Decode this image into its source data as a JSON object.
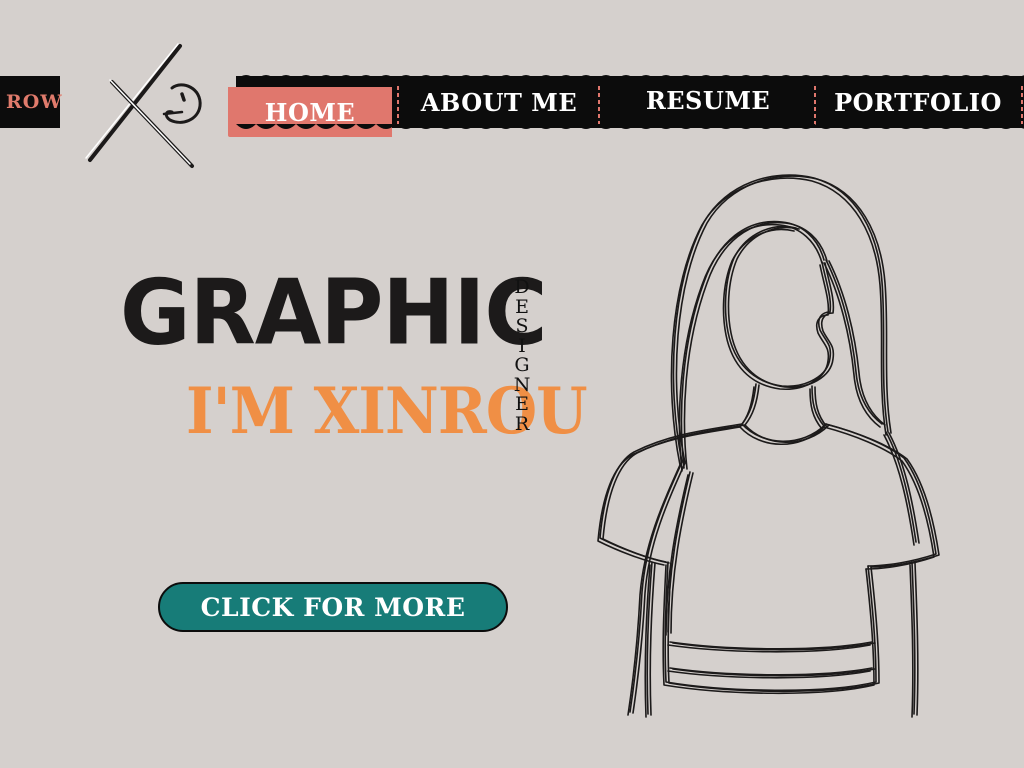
{
  "edge_tab": {
    "label": "ROW"
  },
  "logo": {
    "name": "XR monogram logo"
  },
  "nav": {
    "items": [
      {
        "label": "HOME",
        "active": true
      },
      {
        "label": "ABOUT ME",
        "active": false
      },
      {
        "label": "RESUME",
        "active": false
      },
      {
        "label": "PORTFOLIO",
        "active": false
      }
    ]
  },
  "hero": {
    "title": "GRAPHIC",
    "subtitle": "I'M XINROU",
    "vertical": "DESIGNER"
  },
  "cta": {
    "label": "CLICK FOR MORE"
  },
  "colors": {
    "background": "#d5d0cd",
    "bar": "#0c0c0c",
    "accent_coral": "#e0776d",
    "accent_orange": "#f08f45",
    "accent_teal": "#177c78"
  }
}
